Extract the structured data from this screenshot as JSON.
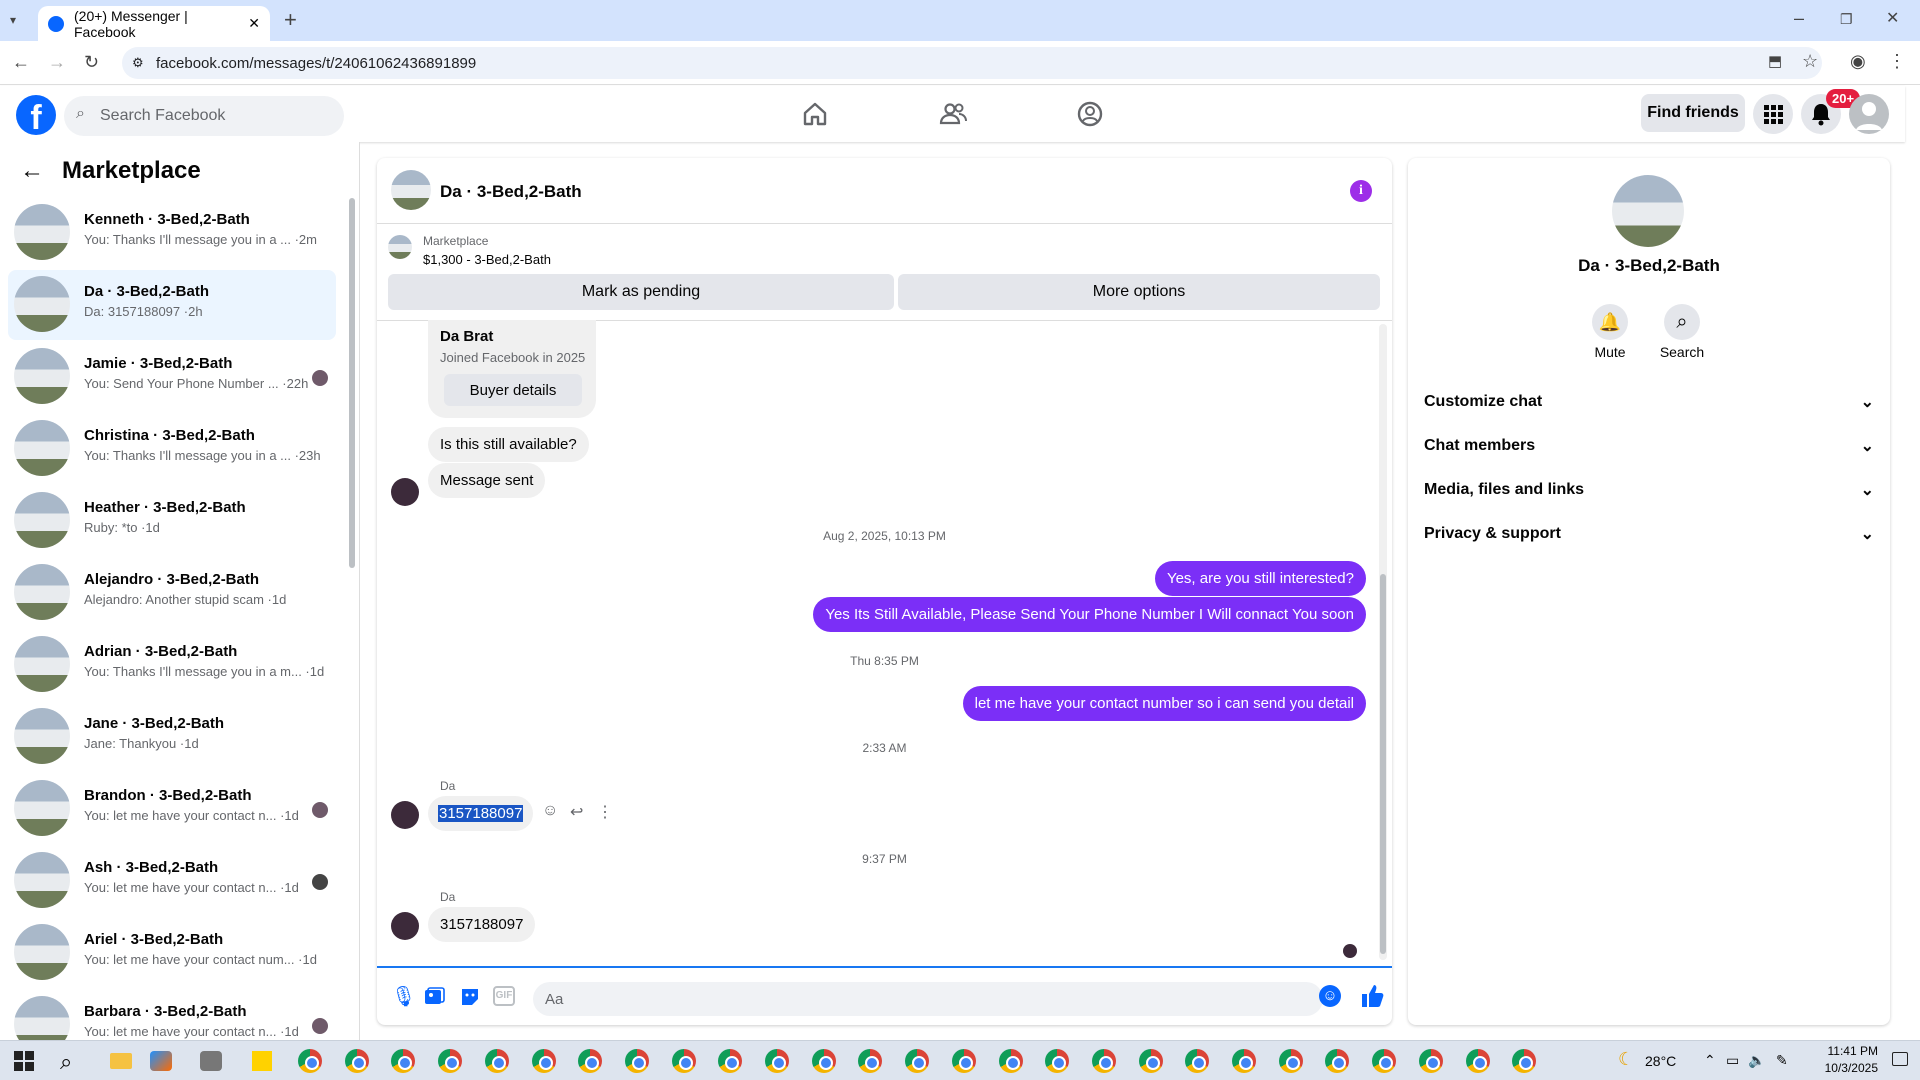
{
  "browser": {
    "tab_title": "(20+) Messenger | Facebook",
    "url": "facebook.com/messages/t/24061062436891899"
  },
  "header": {
    "search_placeholder": "Search Facebook",
    "find_friends": "Find friends",
    "notification_badge": "20+"
  },
  "sidebar": {
    "title": "Marketplace",
    "conversations": [
      {
        "name": "Kenneth · 3-Bed,2-Bath",
        "preview": "You: Thanks I'll message you in a ... ·2m",
        "seen": false
      },
      {
        "name": "Da · 3-Bed,2-Bath",
        "preview": "Da: 3157188097 ·2h",
        "seen": false
      },
      {
        "name": "Jamie · 3-Bed,2-Bath",
        "preview": "You: Send Your Phone Number ... ·22h",
        "seen": true
      },
      {
        "name": "Christina · 3-Bed,2-Bath",
        "preview": "You: Thanks I'll message you in a ... ·23h",
        "seen": false
      },
      {
        "name": "Heather · 3-Bed,2-Bath",
        "preview": "Ruby: *to ·1d",
        "seen": false
      },
      {
        "name": "Alejandro · 3-Bed,2-Bath",
        "preview": "Alejandro: Another stupid scam ·1d",
        "seen": false
      },
      {
        "name": "Adrian · 3-Bed,2-Bath",
        "preview": "You: Thanks I'll message you in a m... ·1d",
        "seen": false
      },
      {
        "name": "Jane · 3-Bed,2-Bath",
        "preview": "Jane: Thankyou ·1d",
        "seen": false
      },
      {
        "name": "Brandon · 3-Bed,2-Bath",
        "preview": "You: let me have your contact n... ·1d",
        "seen": true
      },
      {
        "name": "Ash · 3-Bed,2-Bath",
        "preview": "You: let me have your contact n... ·1d",
        "seen": true
      },
      {
        "name": "Ariel · 3-Bed,2-Bath",
        "preview": "You: let me have your contact num... ·1d",
        "seen": false
      },
      {
        "name": "Barbara · 3-Bed,2-Bath",
        "preview": "You: let me have your contact n... ·1d",
        "seen": true
      }
    ]
  },
  "chat": {
    "title": "Da · 3-Bed,2-Bath",
    "marketplace_label": "Marketplace",
    "listing": "$1,300 - 3-Bed,2-Bath",
    "mark_pending": "Mark as pending",
    "more_options": "More options",
    "buyer_name": "Da Brat",
    "buyer_joined": "Joined Facebook in 2025",
    "buyer_details": "Buyer details",
    "msg_available": "Is this still available?",
    "msg_sent": "Message sent",
    "ts1": "Aug 2, 2025, 10:13 PM",
    "out1": "Yes, are you still interested?",
    "out2": "Yes Its Still Available, Please Send Your Phone Number I Will connact You soon",
    "ts2": "Thu 8:35 PM",
    "out3": "let me have your contact number so i can send you detail",
    "ts3": "2:33 AM",
    "sender1": "Da",
    "in_phone1": "3157188097",
    "ts4": "9:37 PM",
    "sender2": "Da",
    "in_phone2": "3157188097",
    "composer_placeholder": "Aa"
  },
  "right": {
    "name": "Da · 3-Bed,2-Bath",
    "mute": "Mute",
    "search": "Search",
    "sections": [
      "Customize chat",
      "Chat members",
      "Media, files and links",
      "Privacy & support"
    ]
  },
  "taskbar": {
    "temperature": "28°C",
    "time": "11:41 PM",
    "date": "10/3/2025"
  },
  "colors": {
    "accent": "#7b2ff7",
    "facebook_blue": "#0866ff"
  }
}
